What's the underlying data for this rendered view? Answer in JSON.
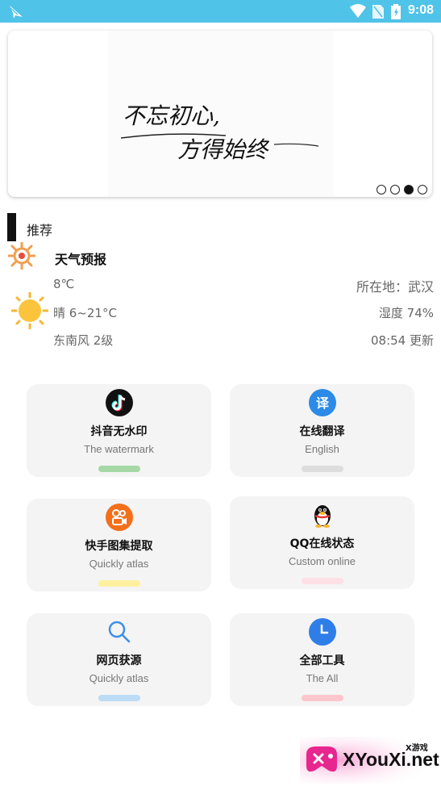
{
  "status_bar": {
    "time": "9:08",
    "color": "#4fc3e8"
  },
  "banner": {
    "calligraphy_line1": "不忘初心,",
    "calligraphy_line2": "方得始终",
    "dots_total": 4,
    "active_dot": 3
  },
  "section": {
    "title": "推荐"
  },
  "weather": {
    "title": "天气预报",
    "current_temp": "8℃",
    "location": "所在地：武汉",
    "condition_range": "晴 6~21°C",
    "humidity": "湿度 74%",
    "wind": "东南风 2级",
    "updated": "08:54 更新"
  },
  "tools": [
    {
      "title": "抖音无水印",
      "subtitle": "The watermark",
      "icon": "tiktok-icon",
      "pill_color": "#a5d8a5"
    },
    {
      "title": "在线翻译",
      "subtitle": "English",
      "icon": "translate-icon",
      "pill_color": "#dddddd"
    },
    {
      "title": "快手图集提取",
      "subtitle": "Quickly atlas",
      "icon": "kuaishou-icon",
      "pill_color": "#fff0a0"
    },
    {
      "title": "QQ在线状态",
      "subtitle": "Custom online",
      "icon": "qq-penguin-icon",
      "pill_color": "#fde0e6"
    },
    {
      "title": "网页获源",
      "subtitle": "Quickly atlas",
      "icon": "search-icon",
      "pill_color": "#bcdcf5"
    },
    {
      "title": "全部工具",
      "subtitle": "The All",
      "icon": "clock-icon",
      "pill_color": "#fcc6cc"
    }
  ],
  "watermark": {
    "text": "XYouXi.net",
    "small": "X游戏"
  }
}
